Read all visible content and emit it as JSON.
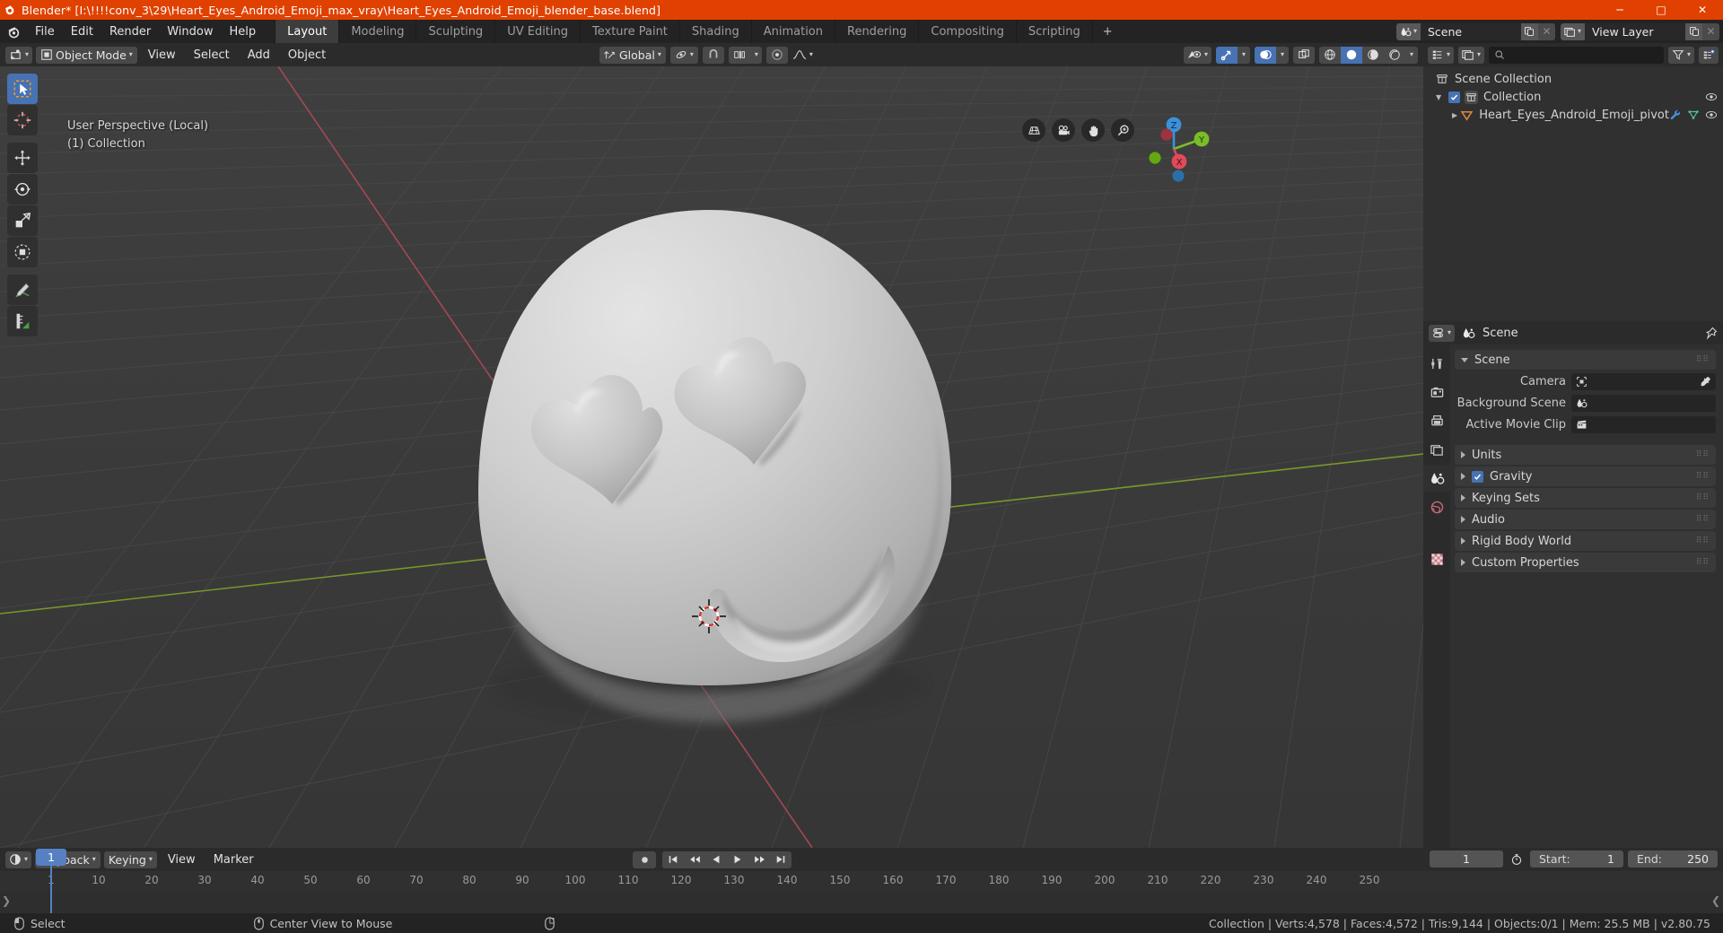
{
  "window": {
    "title": "Blender* [I:\\!!!!conv_3\\29\\Heart_Eyes_Android_Emoji_max_vray\\Heart_Eyes_Android_Emoji_blender_base.blend]",
    "minimize": "─",
    "maximize": "□",
    "close": "✕",
    "accent": "#e04100"
  },
  "topbar": {
    "menus": [
      "File",
      "Edit",
      "Render",
      "Window",
      "Help"
    ],
    "workspaces": [
      {
        "label": "Layout",
        "active": true
      },
      {
        "label": "Modeling",
        "active": false
      },
      {
        "label": "Sculpting",
        "active": false
      },
      {
        "label": "UV Editing",
        "active": false
      },
      {
        "label": "Texture Paint",
        "active": false
      },
      {
        "label": "Shading",
        "active": false
      },
      {
        "label": "Animation",
        "active": false
      },
      {
        "label": "Rendering",
        "active": false
      },
      {
        "label": "Compositing",
        "active": false
      },
      {
        "label": "Scripting",
        "active": false
      }
    ],
    "add_workspace": "+",
    "scene_name": "Scene",
    "view_layer_name": "View Layer"
  },
  "viewport": {
    "mode": "Object Mode",
    "menus": [
      "View",
      "Select",
      "Add",
      "Object"
    ],
    "transform_orientation": "Global",
    "overlay_text_line1": "User Perspective (Local)",
    "overlay_text_line2": "(1) Collection",
    "tools": [
      {
        "name": "select-box-tool",
        "active": true
      },
      {
        "name": "cursor-tool",
        "active": false
      },
      {
        "name": "move-tool",
        "active": false
      },
      {
        "name": "rotate-tool",
        "active": false
      },
      {
        "name": "scale-tool",
        "active": false
      },
      {
        "name": "transform-tool",
        "active": false
      },
      {
        "name": "annotate-tool",
        "active": false
      },
      {
        "name": "measure-tool",
        "active": false
      }
    ],
    "nav_buttons": [
      "grid-toggle-icon",
      "camera-view-icon",
      "pan-view-icon",
      "zoom-view-icon"
    ],
    "gizmo_axes": [
      "Z",
      "Y",
      "X"
    ],
    "shading_modes": [
      "wireframe",
      "solid",
      "material-preview",
      "rendered"
    ],
    "shading_active": "solid",
    "grid_color": "#4a4a4a",
    "bg_color": "#3b3b3b",
    "axis_x_color": "#cc4b5b",
    "axis_y_color": "#7fb800"
  },
  "outliner": {
    "display_mode": "View Layer",
    "search_placeholder": "",
    "rows": [
      {
        "label": "Scene Collection",
        "depth": 0,
        "icon": "collection-icon",
        "expand": "",
        "checkbox": false,
        "eye": false,
        "extra": []
      },
      {
        "label": "Collection",
        "depth": 1,
        "icon": "collection-icon",
        "expand": "▼",
        "checkbox": true,
        "eye": true,
        "extra": []
      },
      {
        "label": "Heart_Eyes_Android_Emoji_pivot",
        "depth": 2,
        "icon": "mesh-object-icon",
        "expand": "▶",
        "checkbox": false,
        "eye": true,
        "extra": [
          "modifier-icon",
          "mesh-data-icon"
        ]
      }
    ]
  },
  "properties": {
    "breadcrumb": "Scene",
    "tabs": [
      {
        "name": "tool-tab",
        "active": false
      },
      {
        "name": "render-tab",
        "active": false
      },
      {
        "name": "output-tab",
        "active": false
      },
      {
        "name": "view-layer-tab",
        "active": false
      },
      {
        "name": "scene-tab",
        "active": true
      },
      {
        "name": "world-tab",
        "active": false
      },
      {
        "name": "object-tab",
        "active": false
      },
      {
        "name": "texture-tab",
        "active": false
      }
    ],
    "panels": [
      {
        "title": "Scene",
        "open": true,
        "rows": [
          {
            "label": "Camera",
            "value": "",
            "field_icon": "camera-data-icon",
            "eyedropper": true
          },
          {
            "label": "Background Scene",
            "value": "",
            "field_icon": "scene-icon",
            "eyedropper": false
          },
          {
            "label": "Active Movie Clip",
            "value": "",
            "field_icon": "movieclip-icon",
            "eyedropper": false
          }
        ]
      },
      {
        "title": "Units",
        "open": false,
        "checkbox": null,
        "rows": []
      },
      {
        "title": "Gravity",
        "open": false,
        "checkbox": true,
        "rows": []
      },
      {
        "title": "Keying Sets",
        "open": false,
        "checkbox": null,
        "rows": []
      },
      {
        "title": "Audio",
        "open": false,
        "checkbox": null,
        "rows": []
      },
      {
        "title": "Rigid Body World",
        "open": false,
        "checkbox": null,
        "rows": []
      },
      {
        "title": "Custom Properties",
        "open": false,
        "checkbox": null,
        "rows": []
      }
    ]
  },
  "timeline": {
    "editor_type": "timeline-icon",
    "menus": [
      "Playback",
      "Keying",
      "View",
      "Marker"
    ],
    "transport": [
      "jump-start",
      "prev-keyframe",
      "play-reverse",
      "play",
      "next-keyframe",
      "jump-end"
    ],
    "record_button": "auto-keying-icon",
    "current_frame": "1",
    "start_label": "Start:",
    "start_value": "1",
    "end_label": "End:",
    "end_value": "250",
    "ruler_ticks": [
      "1",
      "10",
      "20",
      "30",
      "40",
      "50",
      "60",
      "70",
      "80",
      "90",
      "100",
      "110",
      "120",
      "130",
      "140",
      "150",
      "160",
      "170",
      "180",
      "190",
      "200",
      "210",
      "220",
      "230",
      "240",
      "250"
    ],
    "playhead_frame": "1",
    "playhead_color": "#5680c2"
  },
  "statusbar": {
    "left_items": [
      {
        "icon": "mouse-left-icon",
        "label": "Select"
      },
      {
        "icon": "mouse-middle-icon",
        "label": "Center View to Mouse"
      },
      {
        "icon": "mouse-right-icon",
        "label": ""
      }
    ],
    "stats": "Collection | Verts:4,578 | Faces:4,572 | Tris:9,144 | Objects:0/1 | Mem: 25.5 MB | v2.80.75"
  }
}
